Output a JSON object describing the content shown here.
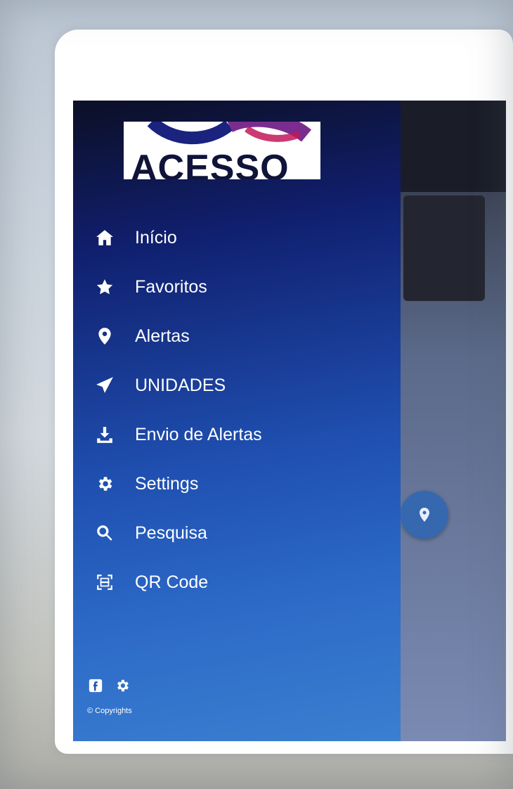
{
  "brand": {
    "logo_text": "ACESSO"
  },
  "menu": {
    "items": [
      {
        "label": "Início",
        "icon": "home-icon"
      },
      {
        "label": "Favoritos",
        "icon": "star-icon"
      },
      {
        "label": "Alertas",
        "icon": "map-pin-icon"
      },
      {
        "label": "UNIDADES",
        "icon": "paper-plane-icon"
      },
      {
        "label": "Envio de Alertas",
        "icon": "download-icon"
      },
      {
        "label": "Settings",
        "icon": "gear-icon"
      },
      {
        "label": "Pesquisa",
        "icon": "search-icon"
      },
      {
        "label": "QR Code",
        "icon": "qr-scan-icon"
      }
    ]
  },
  "footer": {
    "icons": [
      "facebook-icon",
      "gear-icon"
    ],
    "copyright": "© Copyrights"
  },
  "colors": {
    "drawer_top": "#0c0f26",
    "drawer_mid": "#1f4fb0",
    "drawer_bottom": "#3a7fd0",
    "fab": "#3668b0"
  }
}
